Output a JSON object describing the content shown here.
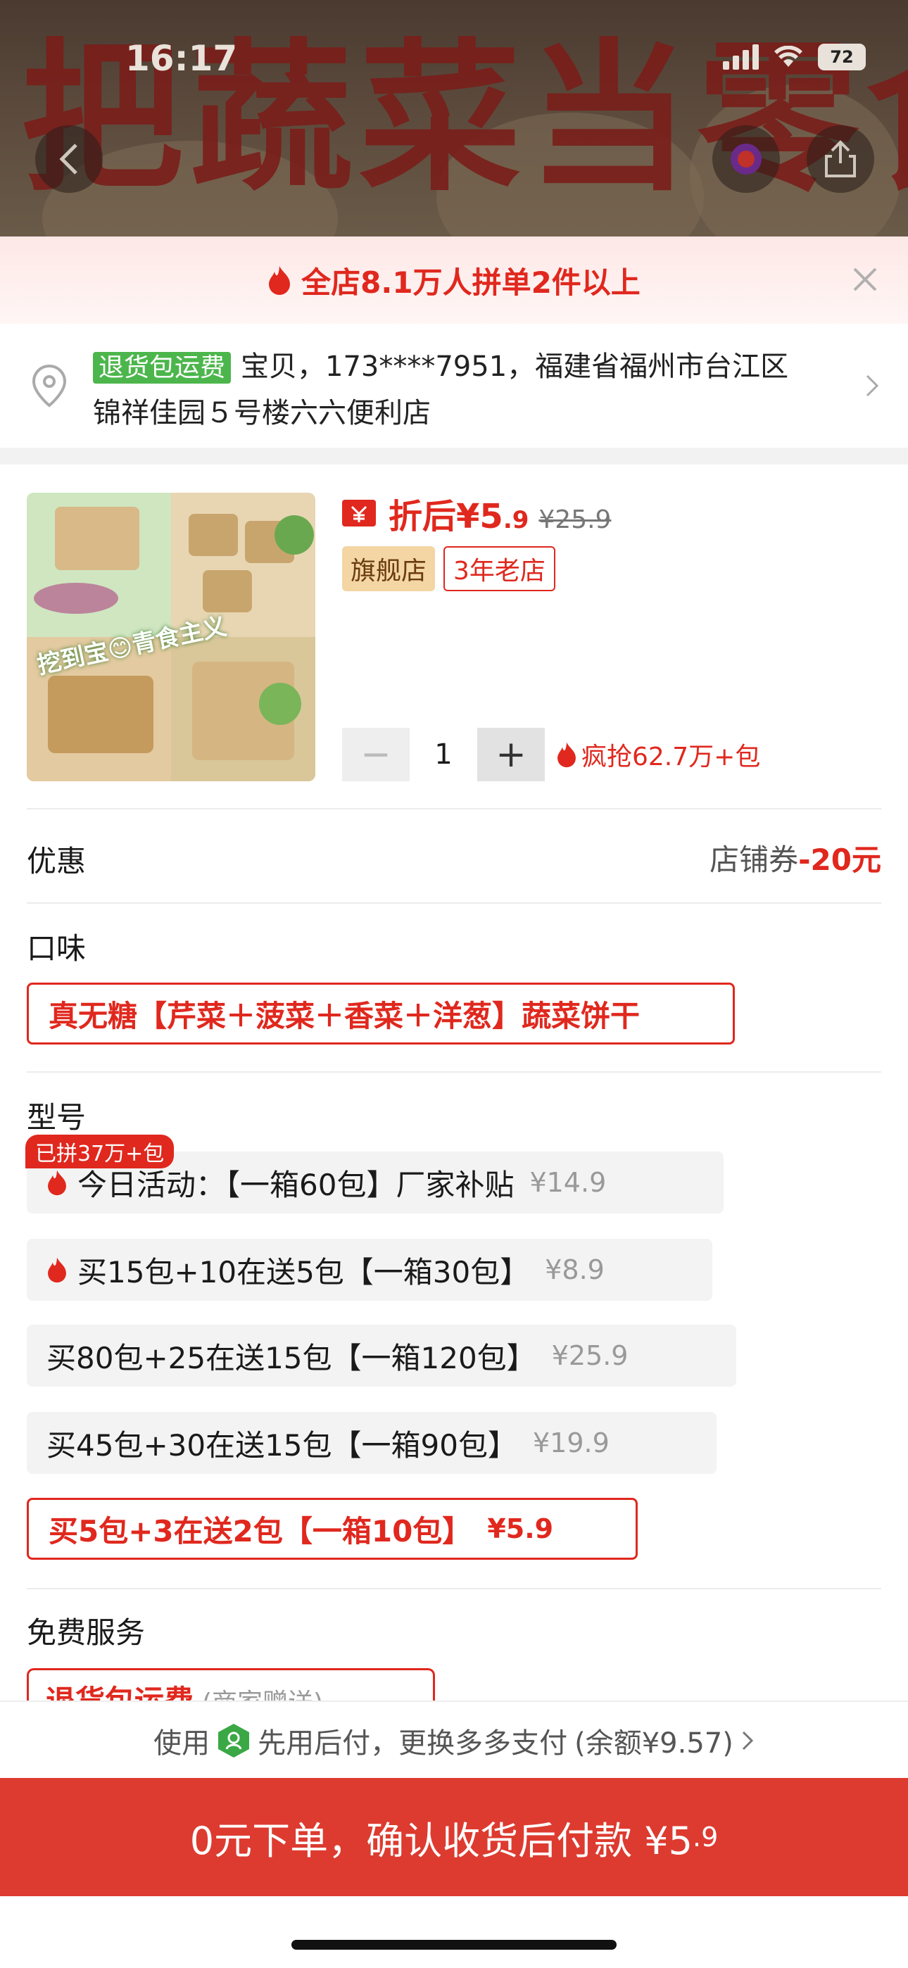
{
  "status": {
    "time": "16:17",
    "battery": "72"
  },
  "hero": {
    "banner_text": "把蔬菜当零食"
  },
  "promo": {
    "text": "全店8.1万人拼单2件以上"
  },
  "address": {
    "tag": "退货包运费",
    "line1": "宝贝，173****7951，福建省福州市台江区",
    "line2": "锦祥佳园５号楼六六便利店"
  },
  "product": {
    "image_caption": "挖到宝😊青食主义",
    "price_prefix": "折后¥5",
    "price_decimal": ".9",
    "original_price": "¥25.9",
    "badge_flagship": "旗舰店",
    "badge_years": "3年老店",
    "quantity": "1",
    "minus": "−",
    "plus": "+",
    "hot_sales": "疯抢62.7万+包"
  },
  "discount": {
    "label": "优惠",
    "coupon_text": "店铺券",
    "coupon_value": "-20元"
  },
  "flavor": {
    "label": "口味",
    "selected": "真无糖【芹菜＋菠菜＋香菜＋洋葱】蔬菜饼干"
  },
  "model": {
    "label": "型号",
    "joined_badge": "已拼37万+包",
    "options": [
      {
        "text": "今日活动：【一箱60包】厂家补贴",
        "price": "¥14.9"
      },
      {
        "text": "买15包+10在送5包【一箱30包】",
        "price": "¥8.9"
      },
      {
        "text": "买80包+25在送15包【一箱120包】",
        "price": "¥25.9"
      },
      {
        "text": "买45包+30在送15包【一箱90包】",
        "price": "¥19.9"
      },
      {
        "text": "买5包+3在送2包【一箱10包】",
        "price": "¥5.9"
      }
    ]
  },
  "services": {
    "label": "免费服务",
    "chip": "退货包运费",
    "chip_sub": "(商家赠送)"
  },
  "payment": {
    "use": "使用",
    "method": "先用后付，更换多多支付",
    "balance": "(余额¥9.57)"
  },
  "cta": {
    "main": "0元下单，确认收货后付款 ¥5",
    "decimal": ".9"
  },
  "colors": {
    "accent": "#e0281e",
    "cta_bg": "#dd3b30",
    "tag_green": "#4cb64c"
  }
}
